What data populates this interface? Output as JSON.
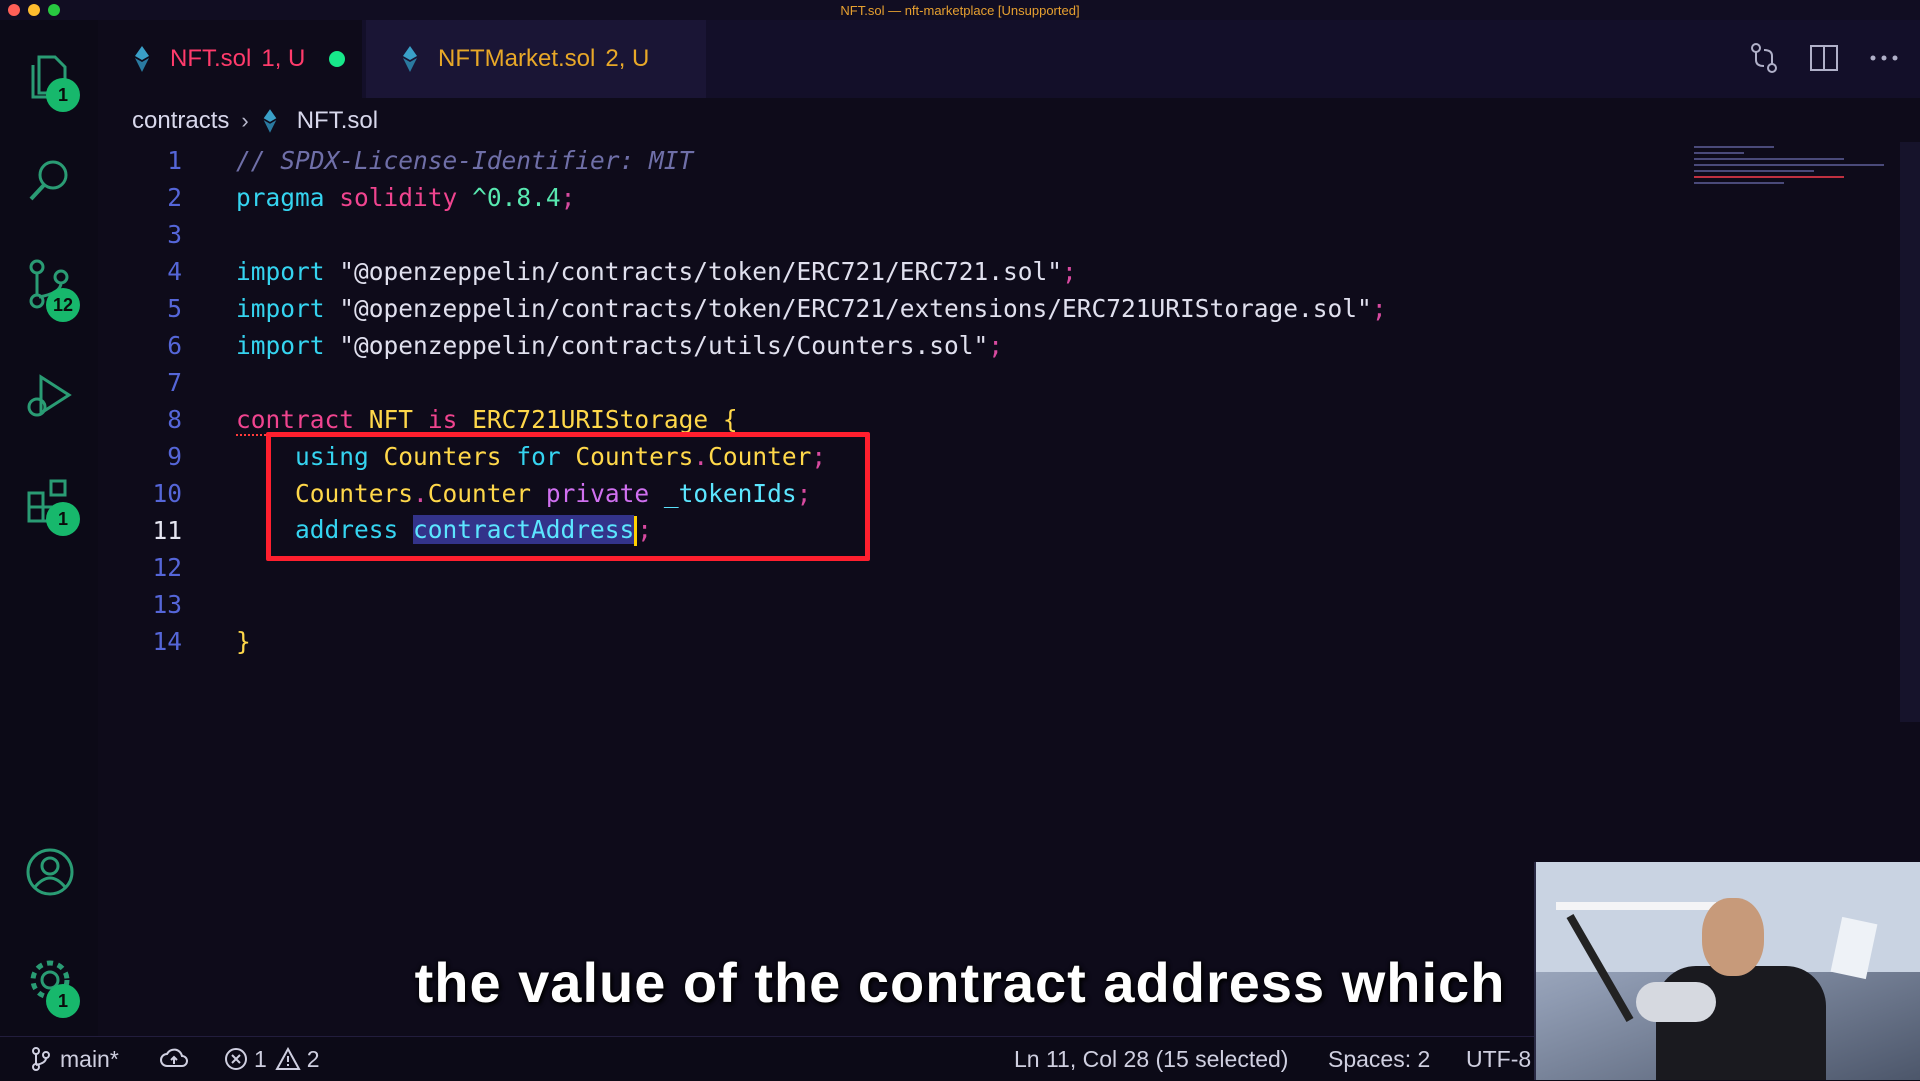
{
  "window": {
    "title": "NFT.sol — nft-marketplace [Unsupported]"
  },
  "activity_bar": {
    "explorer_badge": "1",
    "scm_badge": "12",
    "extensions_badge": "1",
    "settings_badge": "1"
  },
  "tabs": [
    {
      "name": "NFT.sol",
      "status": "1, U",
      "modified": true
    },
    {
      "name": "NFTMarket.sol",
      "status": "2, U",
      "modified": false
    }
  ],
  "breadcrumb": {
    "folder": "contracts",
    "file": "NFT.sol"
  },
  "editor": {
    "line_numbers": [
      "1",
      "2",
      "3",
      "4",
      "5",
      "6",
      "7",
      "8",
      "9",
      "10",
      "11",
      "12",
      "13",
      "14"
    ],
    "current_line": "11",
    "l1": {
      "comment": "// SPDX-License-Identifier: MIT"
    },
    "l2": {
      "kw": "pragma",
      "name": "solidity",
      "ver": "^0.8.4",
      "semi": ";"
    },
    "l4": {
      "kw": "import",
      "path": "\"@openzeppelin/contracts/token/ERC721/ERC721.sol\"",
      "semi": ";"
    },
    "l5": {
      "kw": "import",
      "path": "\"@openzeppelin/contracts/token/ERC721/extensions/ERC721URIStorage.sol\"",
      "semi": ";"
    },
    "l6": {
      "kw": "import",
      "path": "\"@openzeppelin/contracts/utils/Counters.sol\"",
      "semi": ";"
    },
    "l8": {
      "kw": "contract",
      "name": "NFT",
      "is": "is",
      "base": "ERC721URIStorage",
      "brace": "{"
    },
    "l9": {
      "using": "using",
      "lib": "Counters",
      "for": "for",
      "ns": "Counters",
      "dot": ".",
      "type": "Counter",
      "semi": ";"
    },
    "l10": {
      "ns": "Counters",
      "dot": ".",
      "type": "Counter",
      "priv": "private",
      "ident": "_tokenIds",
      "semi": ";"
    },
    "l11": {
      "type": "address",
      "ident": "contractAddress",
      "semi": ";"
    },
    "l14": {
      "brace": "}"
    }
  },
  "statusbar": {
    "branch": "main*",
    "errors": "1",
    "warnings": "2",
    "position": "Ln 11, Col 28 (15 selected)",
    "spaces": "Spaces: 2",
    "encoding": "UTF-8"
  },
  "subtitle": "the value of the contract address which",
  "icons": {
    "explorer": "files-icon",
    "search": "search-icon",
    "scm": "source-control-icon",
    "debug": "run-debug-icon",
    "extensions": "extensions-icon",
    "account": "account-icon",
    "settings": "gear-icon",
    "solidity": "solidity-file-icon"
  }
}
